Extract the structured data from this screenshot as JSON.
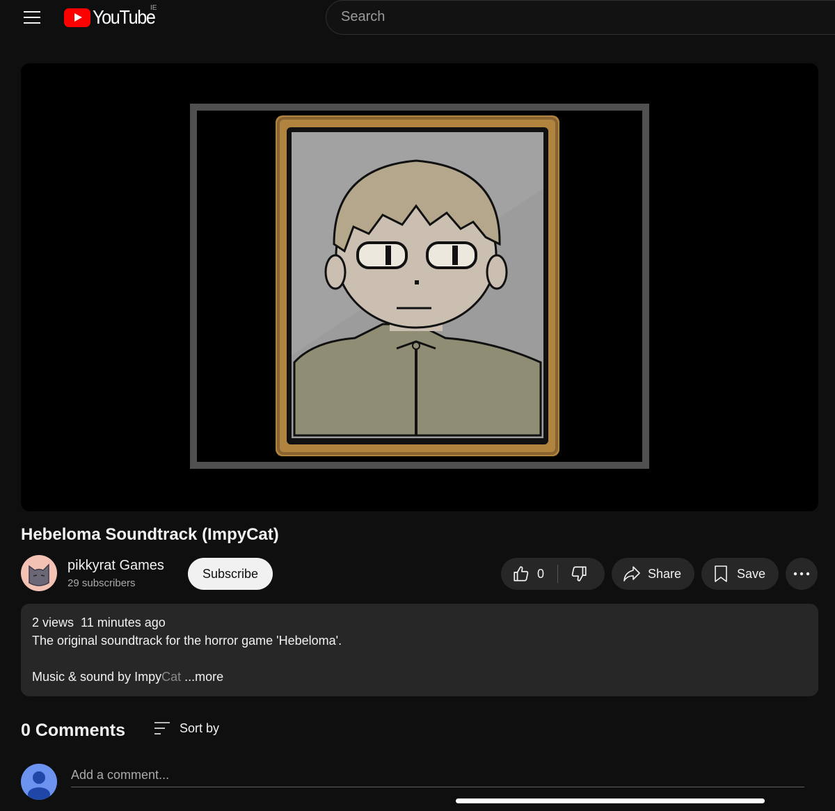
{
  "header": {
    "logo_text": "YouTube",
    "country_code": "IE",
    "search_placeholder": "Search"
  },
  "video": {
    "title": "Hebeloma Soundtrack (ImpyCat)"
  },
  "channel": {
    "name": "pikkyrat Games",
    "subscribers": "29 subscribers",
    "subscribe_label": "Subscribe"
  },
  "actions": {
    "like_count": "0",
    "share_label": "Share",
    "save_label": "Save"
  },
  "description": {
    "views": "2 views",
    "time_ago": "11 minutes ago",
    "line1": "The original soundtrack for the horror game 'Hebeloma'.",
    "line2_visible": "Music & sound by Impy",
    "line2_faded": "Cat",
    "more_label": "...more"
  },
  "comments": {
    "title": "0 Comments",
    "sort_label": "Sort by",
    "add_placeholder": "Add a comment..."
  },
  "colors": {
    "background": "#0f0f0f",
    "pill": "#272727",
    "brand_red": "#ff0000",
    "frame_gold": "#b0833f"
  },
  "icons": [
    "menu-icon",
    "youtube-logo-icon",
    "like-icon",
    "dislike-icon",
    "share-icon",
    "save-icon",
    "more-icon",
    "sort-icon"
  ]
}
